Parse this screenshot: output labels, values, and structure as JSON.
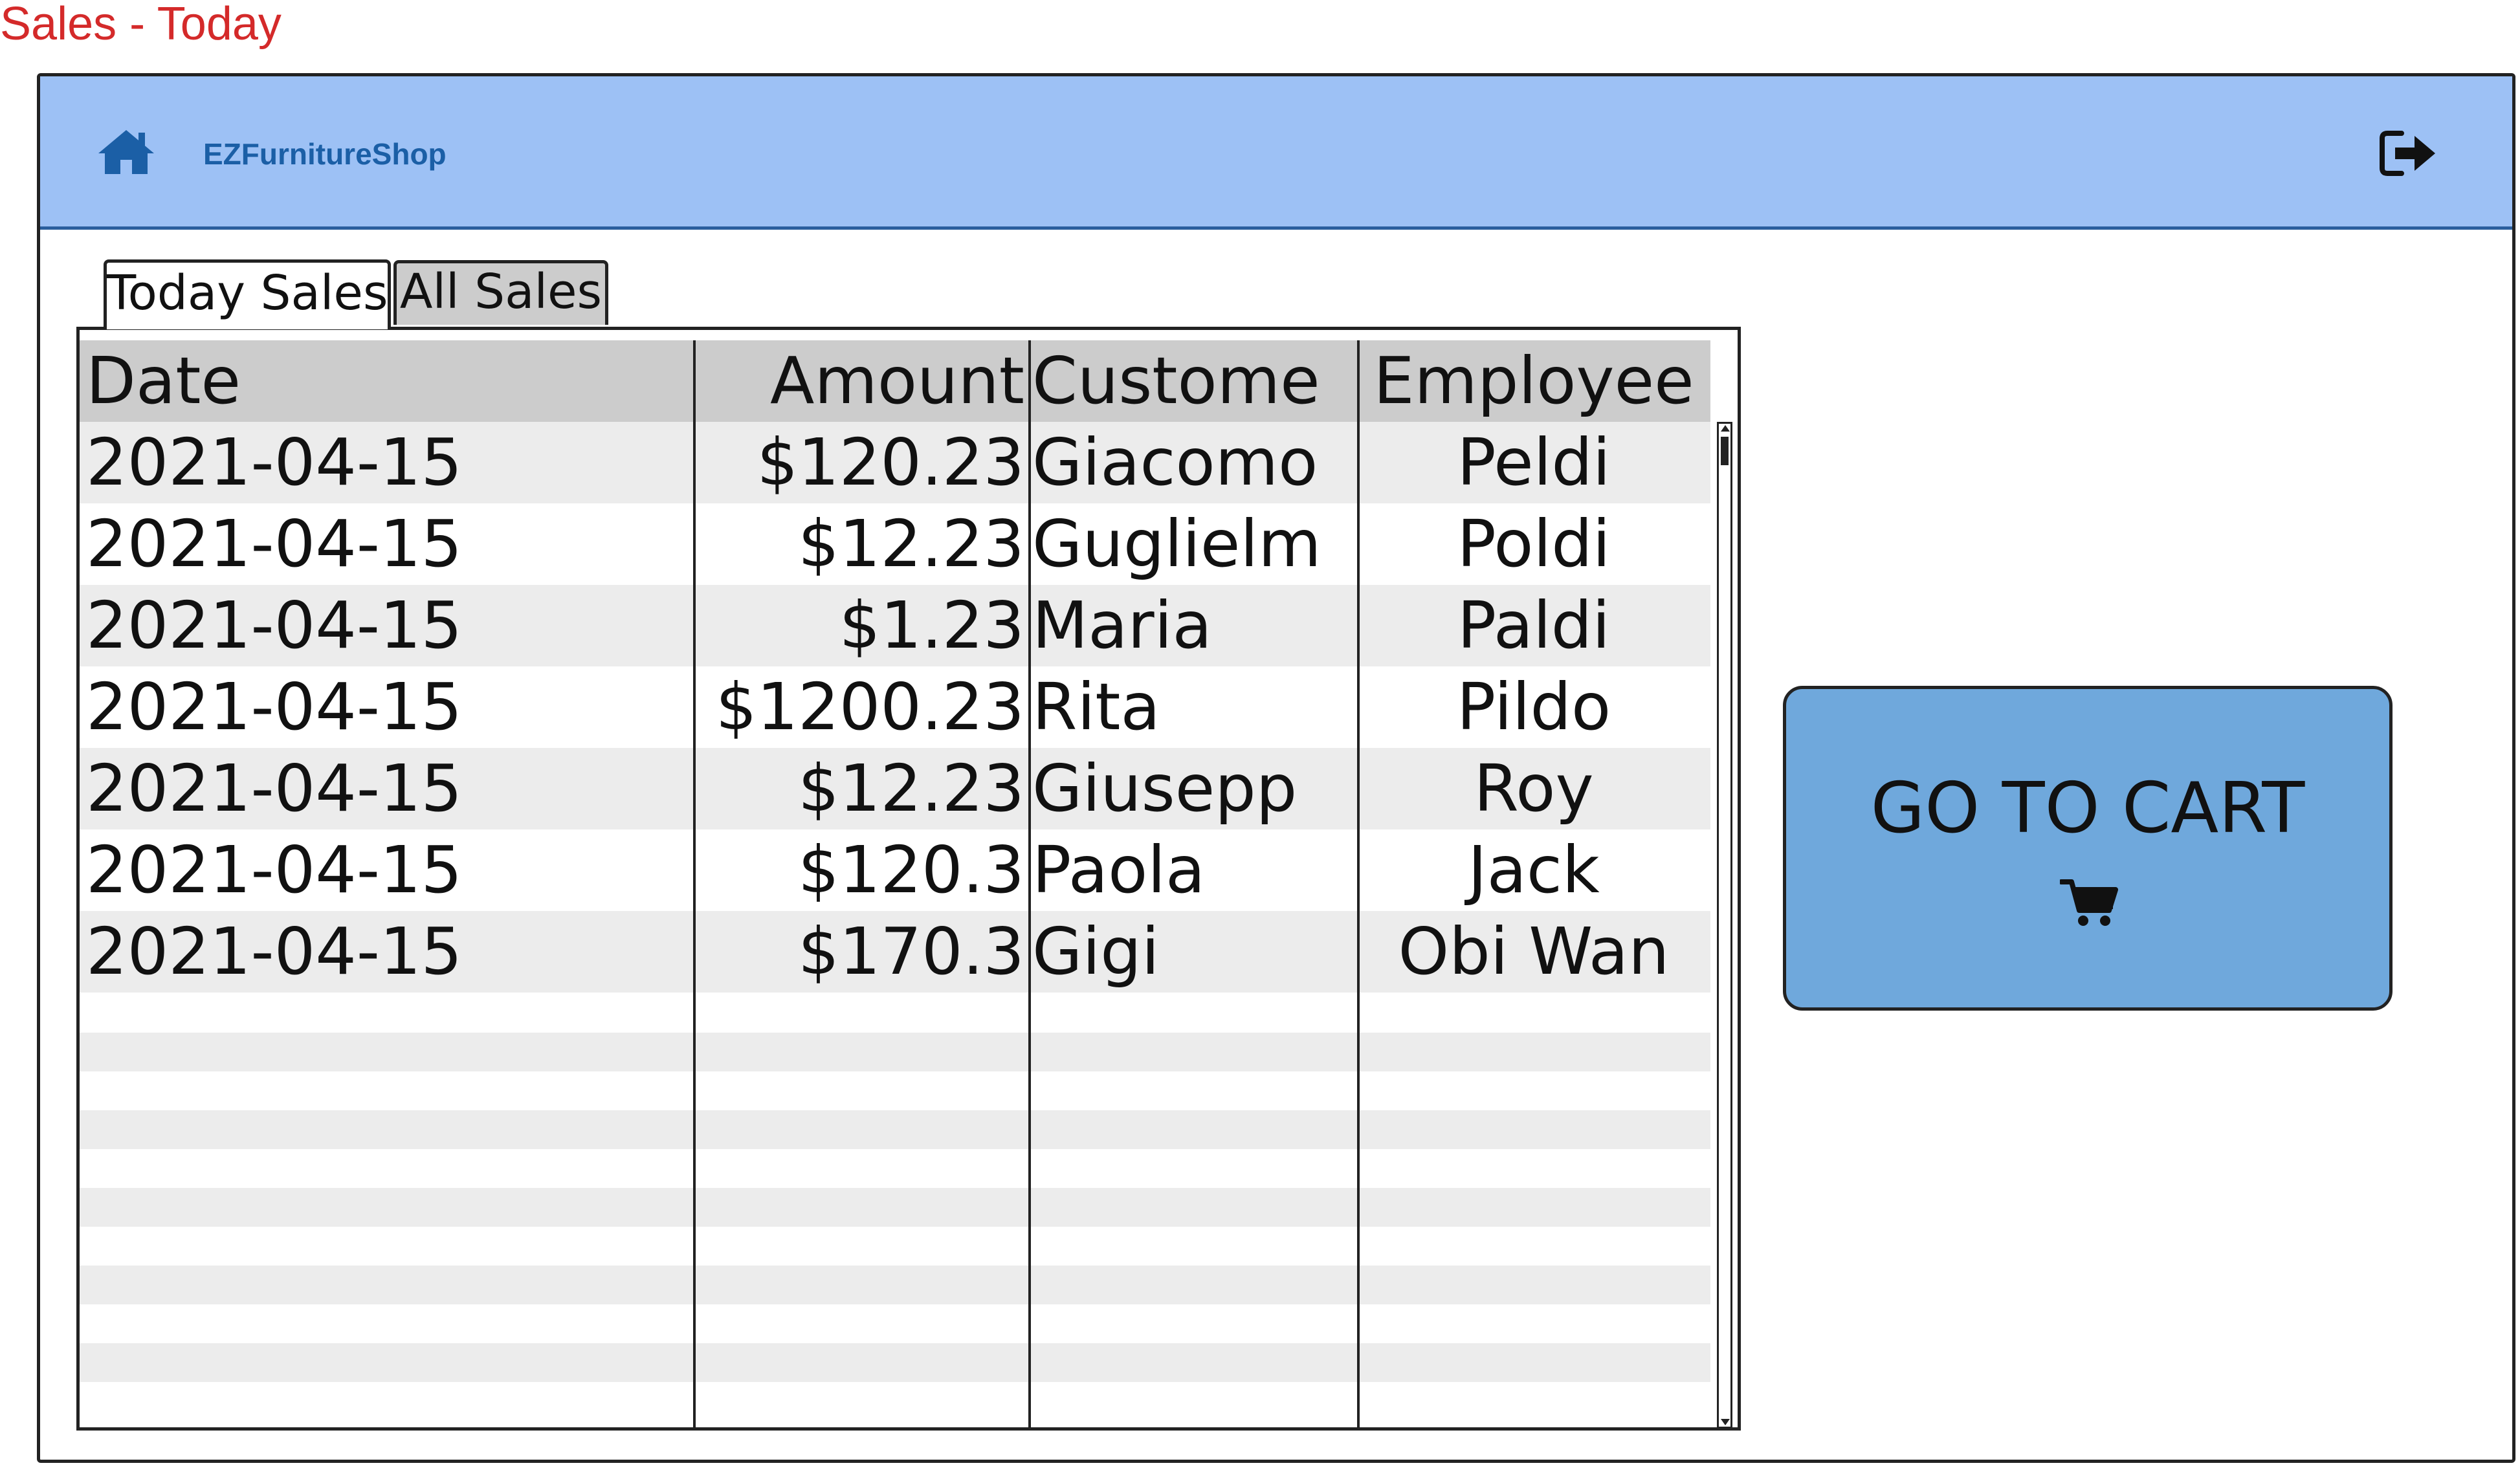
{
  "page_title": "Sales - Today",
  "topbar": {
    "brand": "EZFurnitureShop",
    "home_icon": "home-icon",
    "logout_icon": "logout-icon",
    "background": "#9dc1f5",
    "brand_color": "#1b5fa6"
  },
  "tabs": [
    {
      "label": "Today Sales",
      "active": true
    },
    {
      "label": "All Sales",
      "active": false
    }
  ],
  "table": {
    "columns": [
      "Date",
      "Amount",
      "Custome",
      "Employee"
    ],
    "rows": [
      {
        "date": "2021-04-15",
        "amount": "$120.23",
        "customer": "Giacomo",
        "employee": "Peldi"
      },
      {
        "date": "2021-04-15",
        "amount": "$12.23",
        "customer": "Guglielm",
        "employee": "Poldi"
      },
      {
        "date": "2021-04-15",
        "amount": "$1.23",
        "customer": "Maria",
        "employee": "Paldi"
      },
      {
        "date": "2021-04-15",
        "amount": "$1200.23",
        "customer": "Rita",
        "employee": "Pildo"
      },
      {
        "date": "2021-04-15",
        "amount": "$12.23",
        "customer": "Giusepp",
        "employee": "Roy"
      },
      {
        "date": "2021-04-15",
        "amount": "$120.3",
        "customer": "Paola",
        "employee": "Jack"
      },
      {
        "date": "2021-04-15",
        "amount": "$170.3",
        "customer": "Gigi",
        "employee": "Obi Wan"
      }
    ]
  },
  "cart_button": {
    "label": "GO TO CART",
    "icon": "cart-icon",
    "background": "#6fa8dc"
  }
}
